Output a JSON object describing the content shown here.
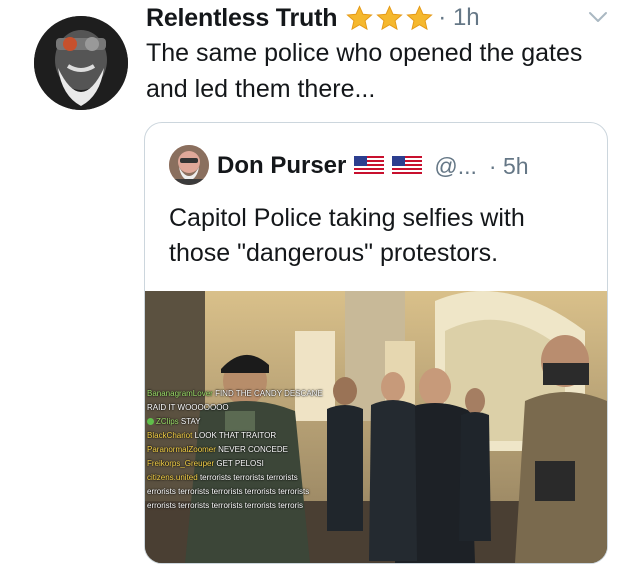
{
  "tweet": {
    "author_name": "Relentless Truth",
    "time": "· 1h",
    "text": "The same police who opened the gates and led them there...",
    "icons": {
      "star": "star-emoji-icon",
      "menu": "chevron-down-icon"
    }
  },
  "quoted_tweet": {
    "author_name": "Don Purser",
    "handle": "@...",
    "time": "· 5h",
    "text": "Capitol Police taking selfies with those \"dangerous\" protestors.",
    "icons": {
      "flag": "us-flag-emoji-icon"
    }
  },
  "video_chat": [
    {
      "user": "BananagramLover",
      "message": "FIND THE CANDY DESCANE"
    },
    {
      "user": "",
      "message": "RAID IT WOOOOOOO"
    },
    {
      "user": "ZClips",
      "message": "STAY"
    },
    {
      "user": "BlackChariot",
      "message": "LOOK THAT TRAITOR"
    },
    {
      "user": "ParanormalZoomer",
      "message": "NEVER CONCEDE"
    },
    {
      "user": "Freikorps_Greuper",
      "message": "GET PELOSI"
    },
    {
      "user": "citizens.united",
      "message": "terrorists terrorists terrorists"
    },
    {
      "user": "",
      "message": "errorists terrorists terrorists terrorists terrorists"
    },
    {
      "user": "",
      "message": "errorists terrorists terrorists terrorists terroris"
    }
  ],
  "colors": {
    "text": "#14171a",
    "secondary": "#657786",
    "border": "#ccd6dd",
    "star": "#f5b82e"
  }
}
